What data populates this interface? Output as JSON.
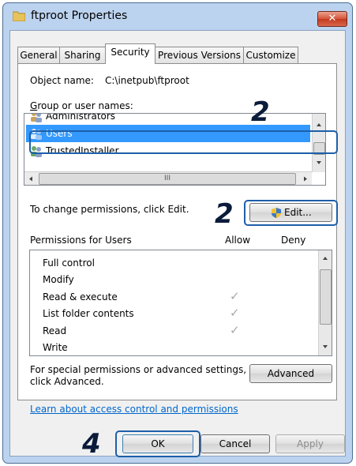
{
  "window": {
    "title": "ftproot Properties",
    "close_label": "✕"
  },
  "tabs": [
    "General",
    "Sharing",
    "Security",
    "Previous Versions",
    "Customize"
  ],
  "security": {
    "object_name_label": "Object name:",
    "object_name_value": "C:\\inetpub\\ftproot",
    "group_label": "Group or user names:",
    "users": [
      "Administrators",
      "Users",
      "TrustedInstaller"
    ],
    "selected_user": "Users",
    "scroll_mark": "III",
    "change_text": "To change permissions, click Edit.",
    "edit_label": "Edit...",
    "permissions_header": "Permissions for Users",
    "allow_header": "Allow",
    "deny_header": "Deny",
    "permissions": [
      {
        "name": "Full control",
        "allow": false
      },
      {
        "name": "Modify",
        "allow": false
      },
      {
        "name": "Read & execute",
        "allow": true
      },
      {
        "name": "List folder contents",
        "allow": true
      },
      {
        "name": "Read",
        "allow": true
      },
      {
        "name": "Write",
        "allow": false
      }
    ],
    "check_mark": "✓",
    "special_text_1": "For special permissions or advanced settings,",
    "special_text_2": "click Advanced.",
    "advanced_label": "Advanced",
    "learn_link": "Learn about access control and permissions"
  },
  "buttons": {
    "ok": "OK",
    "cancel": "Cancel",
    "apply": "Apply"
  },
  "steps": {
    "users_step": "2",
    "edit_step": "2",
    "ok_step": "4"
  }
}
